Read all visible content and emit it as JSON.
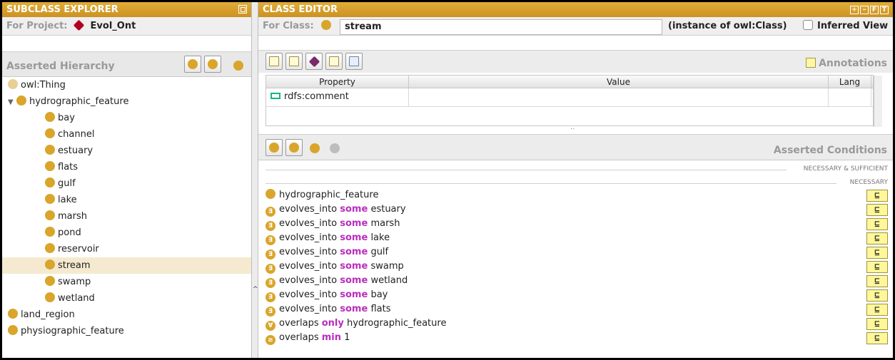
{
  "subclass_explorer": {
    "title": "SUBCLASS EXPLORER",
    "for_project_label": "For Project:",
    "project_name": "Evol_Ont",
    "hierarchy_label": "Asserted Hierarchy",
    "tree": [
      {
        "label": "owl:Thing",
        "depth": 0,
        "expanded": false,
        "light": true
      },
      {
        "label": "hydrographic_feature",
        "depth": 0,
        "expanded": true
      },
      {
        "label": "bay",
        "depth": 1
      },
      {
        "label": "channel",
        "depth": 1
      },
      {
        "label": "estuary",
        "depth": 1
      },
      {
        "label": "flats",
        "depth": 1
      },
      {
        "label": "gulf",
        "depth": 1
      },
      {
        "label": "lake",
        "depth": 1
      },
      {
        "label": "marsh",
        "depth": 1
      },
      {
        "label": "pond",
        "depth": 1
      },
      {
        "label": "reservoir",
        "depth": 1
      },
      {
        "label": "stream",
        "depth": 1,
        "selected": true
      },
      {
        "label": "swamp",
        "depth": 1
      },
      {
        "label": "wetland",
        "depth": 1
      },
      {
        "label": "land_region",
        "depth": 0
      },
      {
        "label": "physiographic_feature",
        "depth": 0
      }
    ]
  },
  "class_editor": {
    "title": "CLASS EDITOR",
    "for_class_label": "For Class:",
    "class_name": "stream",
    "instance_of": "(instance of owl:Class)",
    "inferred_view_label": "Inferred View",
    "annotations_label": "Annotations",
    "table_headers": [
      "Property",
      "Value",
      "Lang"
    ],
    "table_rows": [
      {
        "property": "rdfs:comment",
        "value": "",
        "lang": ""
      }
    ],
    "splitter_dots": "··",
    "asserted_conditions_label": "Asserted Conditions",
    "section_nec_suff": "NECESSARY & SUFFICIENT",
    "section_necessary": "NECESSARY",
    "subset_symbol": "⊑",
    "conditions": [
      {
        "icon": "",
        "parts": [
          {
            "t": "hydrographic_feature"
          }
        ]
      },
      {
        "icon": "∃",
        "parts": [
          {
            "t": "evolves_into "
          },
          {
            "t": "some",
            "kw": true
          },
          {
            "t": " estuary"
          }
        ]
      },
      {
        "icon": "∃",
        "parts": [
          {
            "t": "evolves_into "
          },
          {
            "t": "some",
            "kw": true
          },
          {
            "t": " marsh"
          }
        ]
      },
      {
        "icon": "∃",
        "parts": [
          {
            "t": "evolves_into "
          },
          {
            "t": "some",
            "kw": true
          },
          {
            "t": " lake"
          }
        ]
      },
      {
        "icon": "∃",
        "parts": [
          {
            "t": "evolves_into "
          },
          {
            "t": "some",
            "kw": true
          },
          {
            "t": " gulf"
          }
        ]
      },
      {
        "icon": "∃",
        "parts": [
          {
            "t": "evolves_into "
          },
          {
            "t": "some",
            "kw": true
          },
          {
            "t": " swamp"
          }
        ]
      },
      {
        "icon": "∃",
        "parts": [
          {
            "t": "evolves_into "
          },
          {
            "t": "some",
            "kw": true
          },
          {
            "t": " wetland"
          }
        ]
      },
      {
        "icon": "∃",
        "parts": [
          {
            "t": "evolves_into "
          },
          {
            "t": "some",
            "kw": true
          },
          {
            "t": " bay"
          }
        ]
      },
      {
        "icon": "∃",
        "parts": [
          {
            "t": "evolves_into "
          },
          {
            "t": "some",
            "kw": true
          },
          {
            "t": " flats"
          }
        ]
      },
      {
        "icon": "∀",
        "parts": [
          {
            "t": "overlaps "
          },
          {
            "t": "only",
            "kw": true
          },
          {
            "t": " hydrographic_feature"
          }
        ]
      },
      {
        "icon": "≥",
        "parts": [
          {
            "t": "overlaps "
          },
          {
            "t": "min",
            "kw": true
          },
          {
            "t": " 1"
          }
        ]
      }
    ]
  },
  "colors": {
    "title_bar": "#d29a28",
    "keyword": "#b92dbd",
    "class_icon": "#d9a52b",
    "selection": "#f5ead0",
    "subset_button": "#fff79a"
  }
}
